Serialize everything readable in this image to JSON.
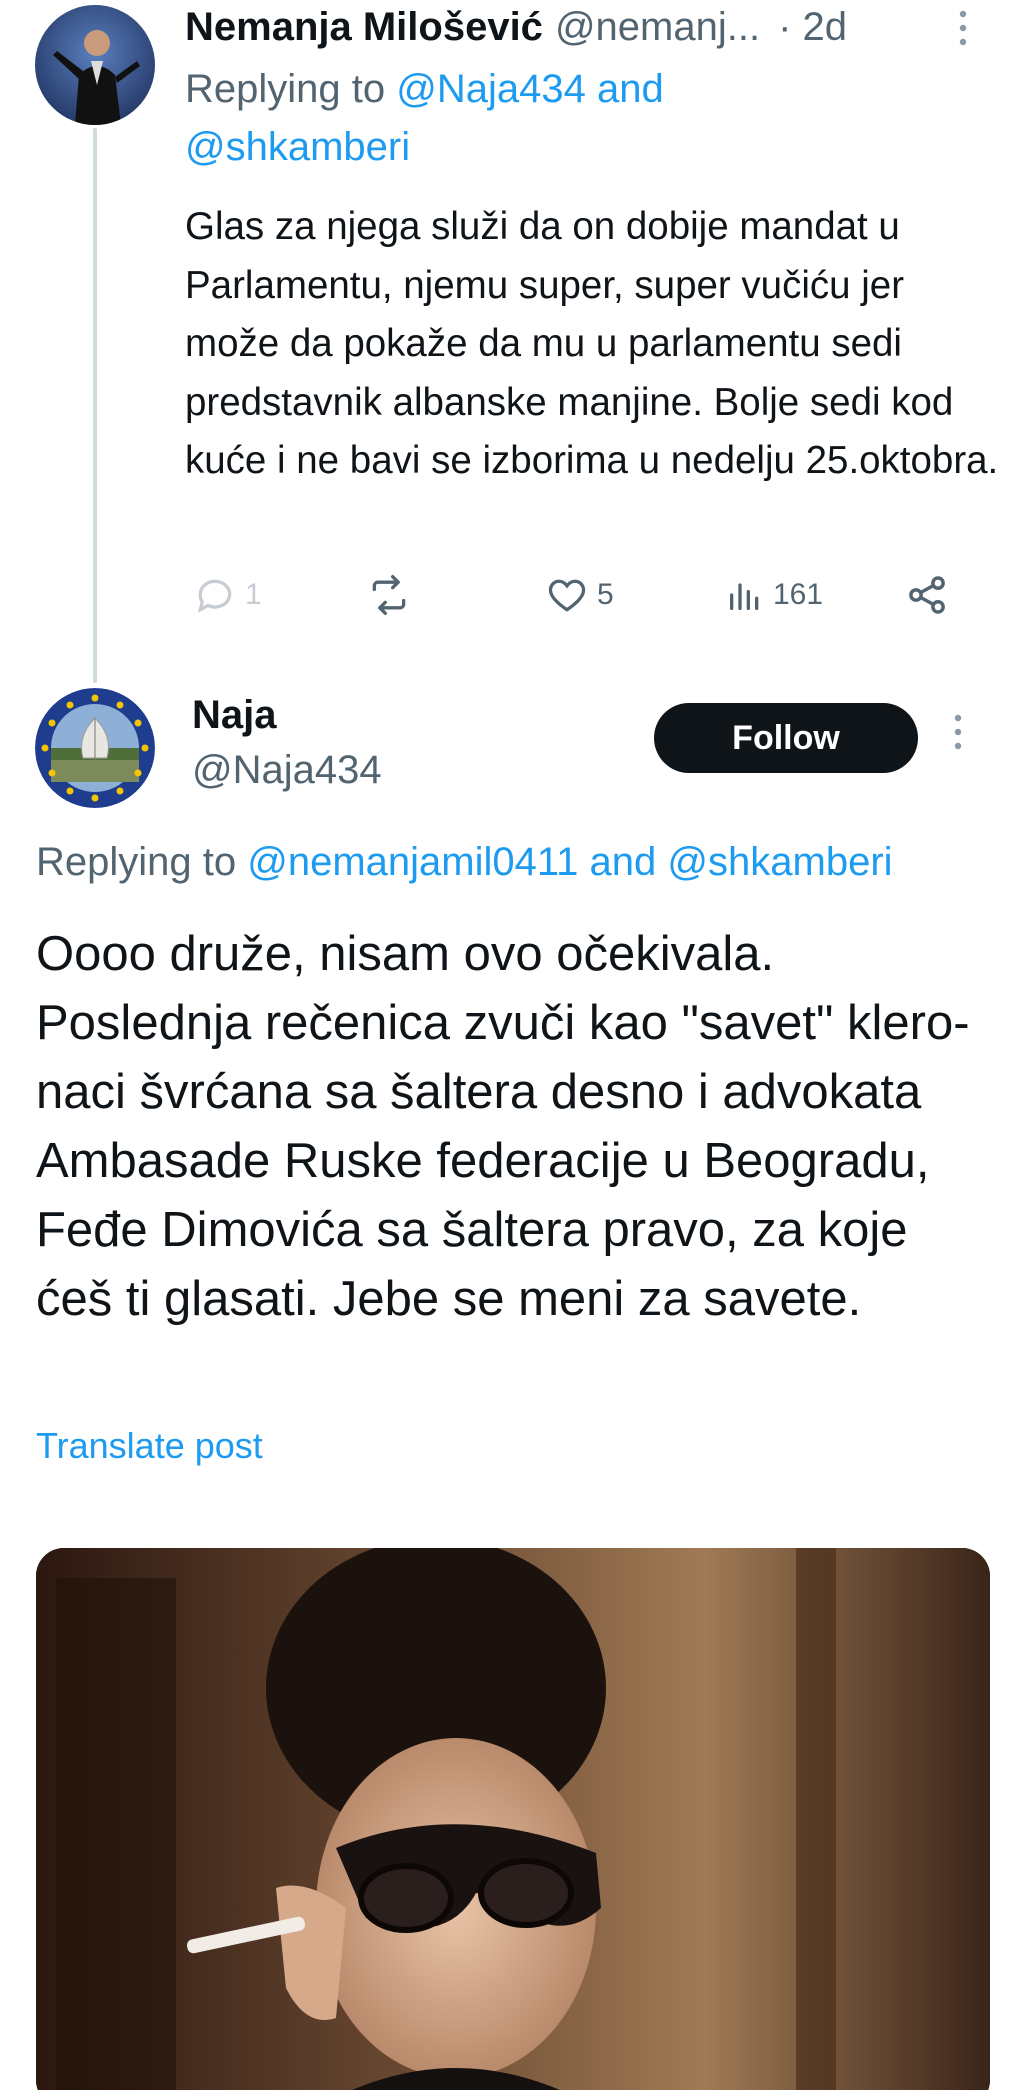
{
  "reply_tweet": {
    "author_name": "Nemanja Milošević",
    "author_handle": "@nemanj...",
    "time": "· 2d",
    "replying_prefix": "Replying to",
    "replying_mention_1": "@Naja434",
    "replying_and": "and",
    "replying_mention_2": "@shkamberi",
    "text": "Glas za njega služi da on dobije mandat u Parlamentu, njemu super, super vučiću jer može da  pokaže da mu u parlamentu sedi predstavnik albanske manjine. Bolje sedi kod kuće i ne bavi se izborima u nedelju 25.oktobra.",
    "actions": {
      "reply_count": "1",
      "like_count": "5",
      "views_count": "161"
    }
  },
  "main_tweet": {
    "author_name": "Naja",
    "author_handle": "@Naja434",
    "follow_label": "Follow",
    "replying_prefix": "Replying to",
    "replying_mention_1": "@nemanjamil0411",
    "replying_and": "and",
    "replying_mention_2": "@shkamberi",
    "text": "Oooo druže, nisam ovo očekivala. Poslednja rečenica zvuči kao \"savet\" klero-naci švrćana sa šaltera desno i advokata Ambasade Ruske federacije u Beogradu, Feđe Dimovića sa šaltera pravo, za koje ćeš ti glasati. Jebe se meni za savete.",
    "translate_label": "Translate post"
  },
  "icons": {
    "reply": "reply-icon",
    "repost": "repost-icon",
    "like": "heart-icon",
    "views": "views-icon",
    "share": "share-icon",
    "more": "more-options-icon"
  },
  "colors": {
    "accent": "#1d9bf0",
    "secondary_text": "#536471",
    "primary_text": "#0f1419",
    "follow_bg": "#0f1419"
  }
}
